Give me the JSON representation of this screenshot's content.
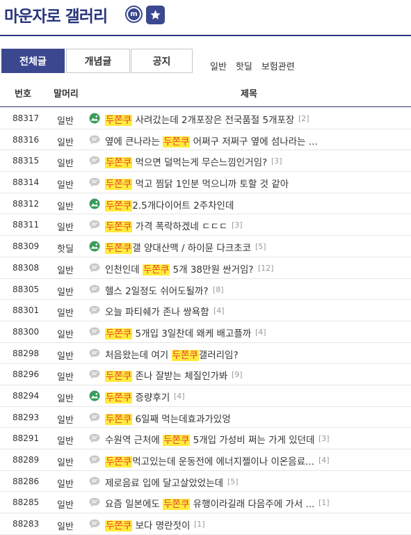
{
  "gallery": {
    "title": "마운자로 갤러리",
    "minor_badge": "m"
  },
  "tabs": [
    {
      "label": "전체글",
      "active": true
    },
    {
      "label": "개념글",
      "active": false
    },
    {
      "label": "공지",
      "active": false
    }
  ],
  "sub_links": [
    "일반",
    "핫딜",
    "보험관련"
  ],
  "table": {
    "headers": {
      "num": "번호",
      "head": "말머리",
      "title": "제목"
    },
    "highlight_color": "#ffeb3b",
    "rows": [
      {
        "num": "88317",
        "head": "일반",
        "icon": "image-post-icon",
        "pre": "",
        "hl": "두쫀쿠",
        "post": " 사려갔는데 2개포장은 전국품절 5개포장",
        "reply": "[2]"
      },
      {
        "num": "88316",
        "head": "일반",
        "icon": "text-post-icon",
        "pre": "옆에 큰나라는 ",
        "hl": "두쫀쿠",
        "post": " 어쩌구 저쩌구 옆에 섬나라는 ...",
        "reply": ""
      },
      {
        "num": "88315",
        "head": "일반",
        "icon": "text-post-icon",
        "pre": "",
        "hl": "두쫀쿠",
        "post": " 먹으면 덜먹는게 무슨느낌인거임?",
        "reply": "[3]"
      },
      {
        "num": "88314",
        "head": "일반",
        "icon": "text-post-icon",
        "pre": "",
        "hl": "두쫀쿠",
        "post": " 먹고 찜닭 1인분 먹으니까 토할 것 같아",
        "reply": ""
      },
      {
        "num": "88312",
        "head": "일반",
        "icon": "image-post-icon",
        "pre": "",
        "hl": "두쫀쿠",
        "post": "2.5개다이어트 2주차인데",
        "reply": ""
      },
      {
        "num": "88311",
        "head": "일반",
        "icon": "text-post-icon",
        "pre": "",
        "hl": "두쫀쿠",
        "post": " 가격 폭락하겠네 ㄷㄷㄷ",
        "reply": "[3]"
      },
      {
        "num": "88309",
        "head": "핫딜",
        "icon": "image-post-icon",
        "pre": "",
        "hl": "두쫀쿠",
        "post": "갤 양대산맥 / 하이뮨 다크초코",
        "reply": "[5]"
      },
      {
        "num": "88308",
        "head": "일반",
        "icon": "text-post-icon",
        "pre": "인천인데 ",
        "hl": "두쫀쿠",
        "post": " 5개 38만원 싼거임?",
        "reply": "[12]"
      },
      {
        "num": "88305",
        "head": "일반",
        "icon": "text-post-icon",
        "pre": "헬스 2일정도 쉬어도될까?",
        "hl": "",
        "post": "",
        "reply": "[8]"
      },
      {
        "num": "88301",
        "head": "일반",
        "icon": "text-post-icon",
        "pre": "오늘 파티쉐가 존나 쌍욕함",
        "hl": "",
        "post": "",
        "reply": "[4]"
      },
      {
        "num": "88300",
        "head": "일반",
        "icon": "text-post-icon",
        "pre": "",
        "hl": "두쫀쿠",
        "post": " 5개입 3일찬데 왜케 배고플까",
        "reply": "[4]"
      },
      {
        "num": "88298",
        "head": "일반",
        "icon": "text-post-icon",
        "pre": "처음왔는데 여기 ",
        "hl": "두쫀쿠",
        "post": "갤러리임?",
        "reply": ""
      },
      {
        "num": "88296",
        "head": "일반",
        "icon": "text-post-icon",
        "pre": "",
        "hl": "두쫀쿠",
        "post": " 존나 잘받는 체질인가봐",
        "reply": "[9]"
      },
      {
        "num": "88294",
        "head": "일반",
        "icon": "image-post-icon",
        "pre": "",
        "hl": "두쫀쿠",
        "post": " 증량후기",
        "reply": "[4]"
      },
      {
        "num": "88293",
        "head": "일반",
        "icon": "text-post-icon",
        "pre": "",
        "hl": "두쫀쿠",
        "post": " 6일째 먹는데효과가있엉",
        "reply": ""
      },
      {
        "num": "88291",
        "head": "일반",
        "icon": "text-post-icon",
        "pre": "수원역 근처에 ",
        "hl": "두쫀쿠",
        "post": " 5개입 가성비 쩌는 가게 있던데",
        "reply": "[3]"
      },
      {
        "num": "88289",
        "head": "일반",
        "icon": "text-post-icon",
        "pre": "",
        "hl": "두쫀쿠",
        "post": "먹고있는데 운동전에 에너지젤이나 이온음료...",
        "reply": "[4]"
      },
      {
        "num": "88286",
        "head": "일반",
        "icon": "text-post-icon",
        "pre": "제로음료 입에 달고살았었는데",
        "hl": "",
        "post": "",
        "reply": "[5]"
      },
      {
        "num": "88285",
        "head": "일반",
        "icon": "text-post-icon",
        "pre": "요즘 일본에도 ",
        "hl": "두쫀쿠",
        "post": " 유행이라길래 다음주에 가서 ...",
        "reply": "[1]"
      },
      {
        "num": "88283",
        "head": "일반",
        "icon": "text-post-icon",
        "pre": "",
        "hl": "두쫀쿠",
        "post": " 보다 명란젓이",
        "reply": "[1]"
      }
    ]
  }
}
